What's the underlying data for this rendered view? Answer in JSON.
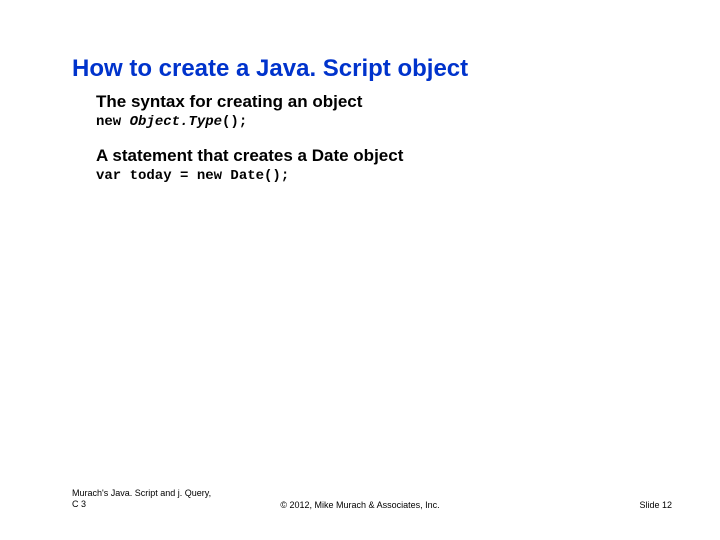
{
  "title": "How to create a Java. Script object",
  "sections": [
    {
      "heading": "The syntax for creating an object",
      "code_parts": [
        {
          "text": "new ",
          "italic": false
        },
        {
          "text": "Object.Type",
          "italic": true
        },
        {
          "text": "();",
          "italic": false
        }
      ]
    },
    {
      "heading": "A statement that creates a Date object",
      "code_parts": [
        {
          "text": "var today = new Date();",
          "italic": false
        }
      ]
    }
  ],
  "footer": {
    "left_line1": "Murach's Java. Script and j. Query,",
    "left_line2": "C 3",
    "center": "© 2012, Mike Murach & Associates, Inc.",
    "right": "Slide 12"
  }
}
